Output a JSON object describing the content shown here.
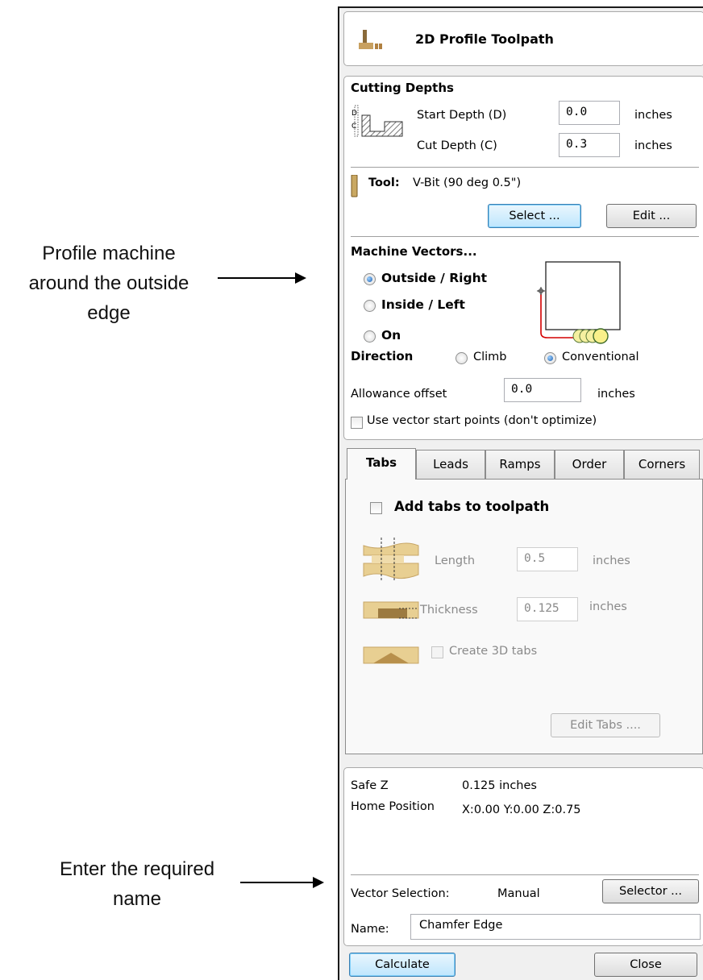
{
  "annotations": {
    "profile_line1": "Profile machine",
    "profile_line2": "around the outside",
    "profile_line3": "edge",
    "name_line1": "Enter the required",
    "name_line2": "name"
  },
  "header": {
    "title": "2D Profile Toolpath"
  },
  "cutting_depths": {
    "title": "Cutting Depths",
    "start_label": "Start Depth (D)",
    "start_value": "0.0",
    "cut_label": "Cut Depth (C)",
    "cut_value": "0.3",
    "unit": "inches",
    "diagram_d": "D",
    "diagram_c": "C"
  },
  "tool": {
    "label": "Tool:",
    "name": "V-Bit (90 deg 0.5\")",
    "select_label": "Select ...",
    "edit_label": "Edit ..."
  },
  "machine": {
    "title": "Machine Vectors...",
    "outside_label": "Outside / Right",
    "inside_label": "Inside / Left",
    "on_label": "On",
    "selected": "Outside / Right",
    "direction_label": "Direction",
    "climb_label": "Climb",
    "conventional_label": "Conventional",
    "direction_selected": "Conventional",
    "allowance_label": "Allowance offset",
    "allowance_value": "0.0",
    "allowance_unit": "inches",
    "start_points_label": "Use vector start points (don't optimize)",
    "start_points_checked": false
  },
  "tabs": {
    "labels": [
      "Tabs",
      "Leads",
      "Ramps",
      "Order",
      "Corners"
    ],
    "active": "Tabs",
    "add_tabs_label": "Add tabs to toolpath",
    "add_tabs_checked": false,
    "length_label": "Length",
    "length_value": "0.5",
    "thickness_label": "Thickness",
    "thickness_value": "0.125",
    "unit": "inches",
    "create3d_label": "Create 3D tabs",
    "edit_tabs_label": "Edit Tabs ...."
  },
  "info": {
    "safez_label": "Safe Z",
    "safez_value": "0.125 inches",
    "home_label": "Home Position",
    "home_value": "X:0.00 Y:0.00 Z:0.75",
    "vector_label": "Vector Selection:",
    "vector_value": "Manual",
    "selector_label": "Selector ...",
    "name_label": "Name:",
    "name_value": "Chamfer Edge"
  },
  "footer": {
    "calculate_label": "Calculate",
    "close_label": "Close"
  },
  "colors": {
    "focus_blue": "#3c7fb1",
    "radio_dot": "#1c5fb0",
    "path_red": "#d40000",
    "wood": "#e8cf92"
  }
}
